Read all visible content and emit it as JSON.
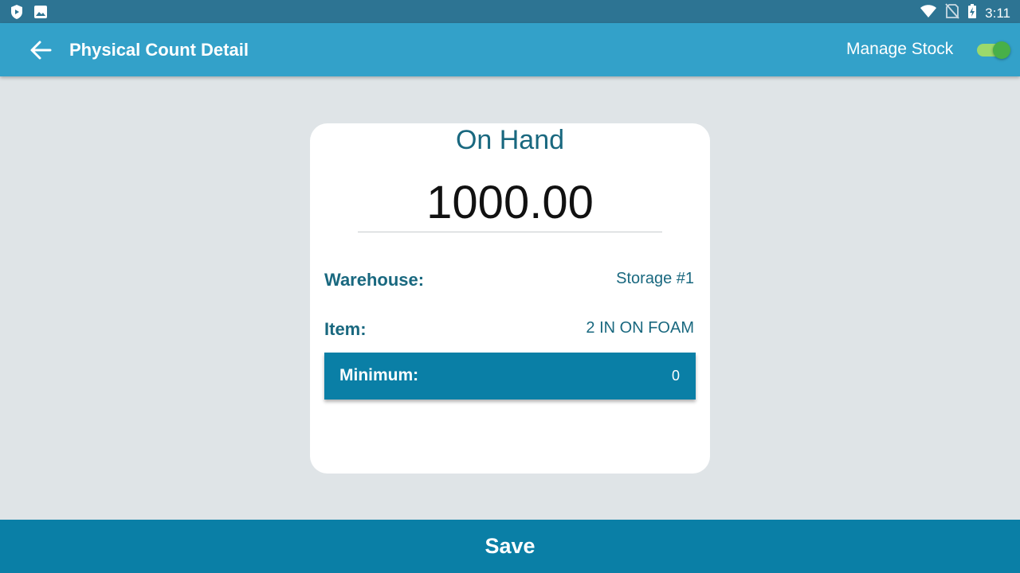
{
  "status_bar": {
    "time": "3:11",
    "icons": [
      "shield-play-icon",
      "image-icon",
      "wifi-icon",
      "no-sim-icon",
      "battery-charging-icon"
    ]
  },
  "app_bar": {
    "title": "Physical Count Detail",
    "back_icon": "arrow-left-icon",
    "manage_stock_label": "Manage Stock",
    "manage_stock_enabled": true
  },
  "card": {
    "on_hand_label": "On Hand",
    "on_hand_value": "1000.00",
    "warehouse_label": "Warehouse:",
    "warehouse_value": "Storage #1",
    "item_label": "Item:",
    "item_value": "2 IN ON FOAM",
    "minimum_label": "Minimum:",
    "minimum_value": "0"
  },
  "footer": {
    "save_label": "Save"
  },
  "colors": {
    "status_bar": "#2d7493",
    "app_bar": "#33a1c9",
    "accent": "#0a7fa6",
    "text_teal": "#19687f",
    "background": "#dfe4e7",
    "toggle_on": "#48b049"
  }
}
